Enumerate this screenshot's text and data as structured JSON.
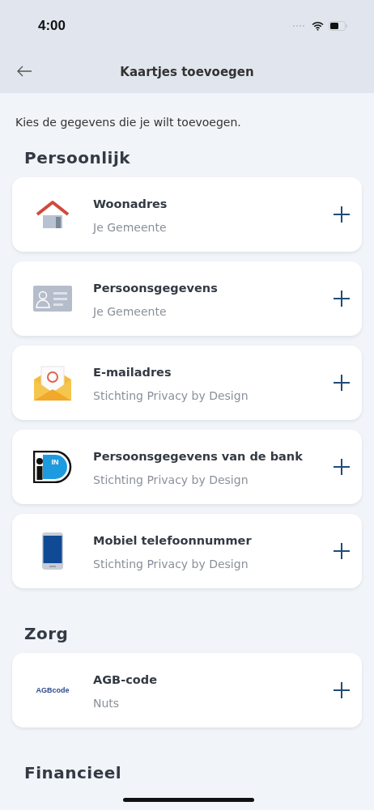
{
  "status_bar": {
    "time": "4:00"
  },
  "header": {
    "title": "Kaartjes toevoegen"
  },
  "intro": "Kies de gegevens die je wilt toevoegen.",
  "sections": [
    {
      "title": "Persoonlijk",
      "cards": [
        {
          "kind": "house",
          "title": "Woonadres",
          "issuer": "Je Gemeente"
        },
        {
          "kind": "id-card",
          "title": "Persoonsgegevens",
          "issuer": "Je Gemeente"
        },
        {
          "kind": "email",
          "title": "E-mailadres",
          "issuer": "Stichting Privacy by Design"
        },
        {
          "kind": "idin",
          "logo_text": "IN",
          "title": "Persoonsgegevens van de bank",
          "issuer": "Stichting Privacy by Design"
        },
        {
          "kind": "phone",
          "title": "Mobiel telefoonnummer",
          "issuer": "Stichting Privacy by Design"
        }
      ]
    },
    {
      "title": "Zorg",
      "cards": [
        {
          "kind": "agb",
          "logo_text": "AGBcode",
          "title": "AGB-code",
          "issuer": "Nuts"
        }
      ]
    },
    {
      "title": "Financieel"
    }
  ]
}
